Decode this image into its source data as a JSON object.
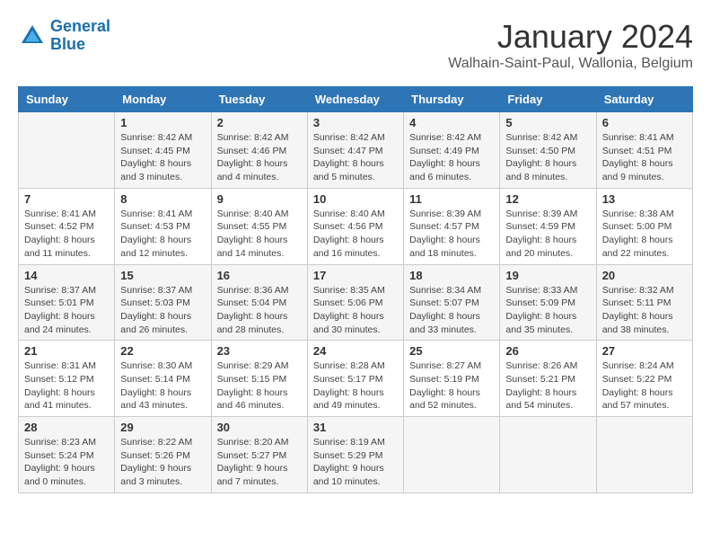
{
  "header": {
    "logo_line1": "General",
    "logo_line2": "Blue",
    "month_title": "January 2024",
    "subtitle": "Walhain-Saint-Paul, Wallonia, Belgium"
  },
  "weekdays": [
    "Sunday",
    "Monday",
    "Tuesday",
    "Wednesday",
    "Thursday",
    "Friday",
    "Saturday"
  ],
  "weeks": [
    [
      {
        "day": "",
        "info": ""
      },
      {
        "day": "1",
        "info": "Sunrise: 8:42 AM\nSunset: 4:45 PM\nDaylight: 8 hours\nand 3 minutes."
      },
      {
        "day": "2",
        "info": "Sunrise: 8:42 AM\nSunset: 4:46 PM\nDaylight: 8 hours\nand 4 minutes."
      },
      {
        "day": "3",
        "info": "Sunrise: 8:42 AM\nSunset: 4:47 PM\nDaylight: 8 hours\nand 5 minutes."
      },
      {
        "day": "4",
        "info": "Sunrise: 8:42 AM\nSunset: 4:49 PM\nDaylight: 8 hours\nand 6 minutes."
      },
      {
        "day": "5",
        "info": "Sunrise: 8:42 AM\nSunset: 4:50 PM\nDaylight: 8 hours\nand 8 minutes."
      },
      {
        "day": "6",
        "info": "Sunrise: 8:41 AM\nSunset: 4:51 PM\nDaylight: 8 hours\nand 9 minutes."
      }
    ],
    [
      {
        "day": "7",
        "info": "Sunrise: 8:41 AM\nSunset: 4:52 PM\nDaylight: 8 hours\nand 11 minutes."
      },
      {
        "day": "8",
        "info": "Sunrise: 8:41 AM\nSunset: 4:53 PM\nDaylight: 8 hours\nand 12 minutes."
      },
      {
        "day": "9",
        "info": "Sunrise: 8:40 AM\nSunset: 4:55 PM\nDaylight: 8 hours\nand 14 minutes."
      },
      {
        "day": "10",
        "info": "Sunrise: 8:40 AM\nSunset: 4:56 PM\nDaylight: 8 hours\nand 16 minutes."
      },
      {
        "day": "11",
        "info": "Sunrise: 8:39 AM\nSunset: 4:57 PM\nDaylight: 8 hours\nand 18 minutes."
      },
      {
        "day": "12",
        "info": "Sunrise: 8:39 AM\nSunset: 4:59 PM\nDaylight: 8 hours\nand 20 minutes."
      },
      {
        "day": "13",
        "info": "Sunrise: 8:38 AM\nSunset: 5:00 PM\nDaylight: 8 hours\nand 22 minutes."
      }
    ],
    [
      {
        "day": "14",
        "info": "Sunrise: 8:37 AM\nSunset: 5:01 PM\nDaylight: 8 hours\nand 24 minutes."
      },
      {
        "day": "15",
        "info": "Sunrise: 8:37 AM\nSunset: 5:03 PM\nDaylight: 8 hours\nand 26 minutes."
      },
      {
        "day": "16",
        "info": "Sunrise: 8:36 AM\nSunset: 5:04 PM\nDaylight: 8 hours\nand 28 minutes."
      },
      {
        "day": "17",
        "info": "Sunrise: 8:35 AM\nSunset: 5:06 PM\nDaylight: 8 hours\nand 30 minutes."
      },
      {
        "day": "18",
        "info": "Sunrise: 8:34 AM\nSunset: 5:07 PM\nDaylight: 8 hours\nand 33 minutes."
      },
      {
        "day": "19",
        "info": "Sunrise: 8:33 AM\nSunset: 5:09 PM\nDaylight: 8 hours\nand 35 minutes."
      },
      {
        "day": "20",
        "info": "Sunrise: 8:32 AM\nSunset: 5:11 PM\nDaylight: 8 hours\nand 38 minutes."
      }
    ],
    [
      {
        "day": "21",
        "info": "Sunrise: 8:31 AM\nSunset: 5:12 PM\nDaylight: 8 hours\nand 41 minutes."
      },
      {
        "day": "22",
        "info": "Sunrise: 8:30 AM\nSunset: 5:14 PM\nDaylight: 8 hours\nand 43 minutes."
      },
      {
        "day": "23",
        "info": "Sunrise: 8:29 AM\nSunset: 5:15 PM\nDaylight: 8 hours\nand 46 minutes."
      },
      {
        "day": "24",
        "info": "Sunrise: 8:28 AM\nSunset: 5:17 PM\nDaylight: 8 hours\nand 49 minutes."
      },
      {
        "day": "25",
        "info": "Sunrise: 8:27 AM\nSunset: 5:19 PM\nDaylight: 8 hours\nand 52 minutes."
      },
      {
        "day": "26",
        "info": "Sunrise: 8:26 AM\nSunset: 5:21 PM\nDaylight: 8 hours\nand 54 minutes."
      },
      {
        "day": "27",
        "info": "Sunrise: 8:24 AM\nSunset: 5:22 PM\nDaylight: 8 hours\nand 57 minutes."
      }
    ],
    [
      {
        "day": "28",
        "info": "Sunrise: 8:23 AM\nSunset: 5:24 PM\nDaylight: 9 hours\nand 0 minutes."
      },
      {
        "day": "29",
        "info": "Sunrise: 8:22 AM\nSunset: 5:26 PM\nDaylight: 9 hours\nand 3 minutes."
      },
      {
        "day": "30",
        "info": "Sunrise: 8:20 AM\nSunset: 5:27 PM\nDaylight: 9 hours\nand 7 minutes."
      },
      {
        "day": "31",
        "info": "Sunrise: 8:19 AM\nSunset: 5:29 PM\nDaylight: 9 hours\nand 10 minutes."
      },
      {
        "day": "",
        "info": ""
      },
      {
        "day": "",
        "info": ""
      },
      {
        "day": "",
        "info": ""
      }
    ]
  ]
}
